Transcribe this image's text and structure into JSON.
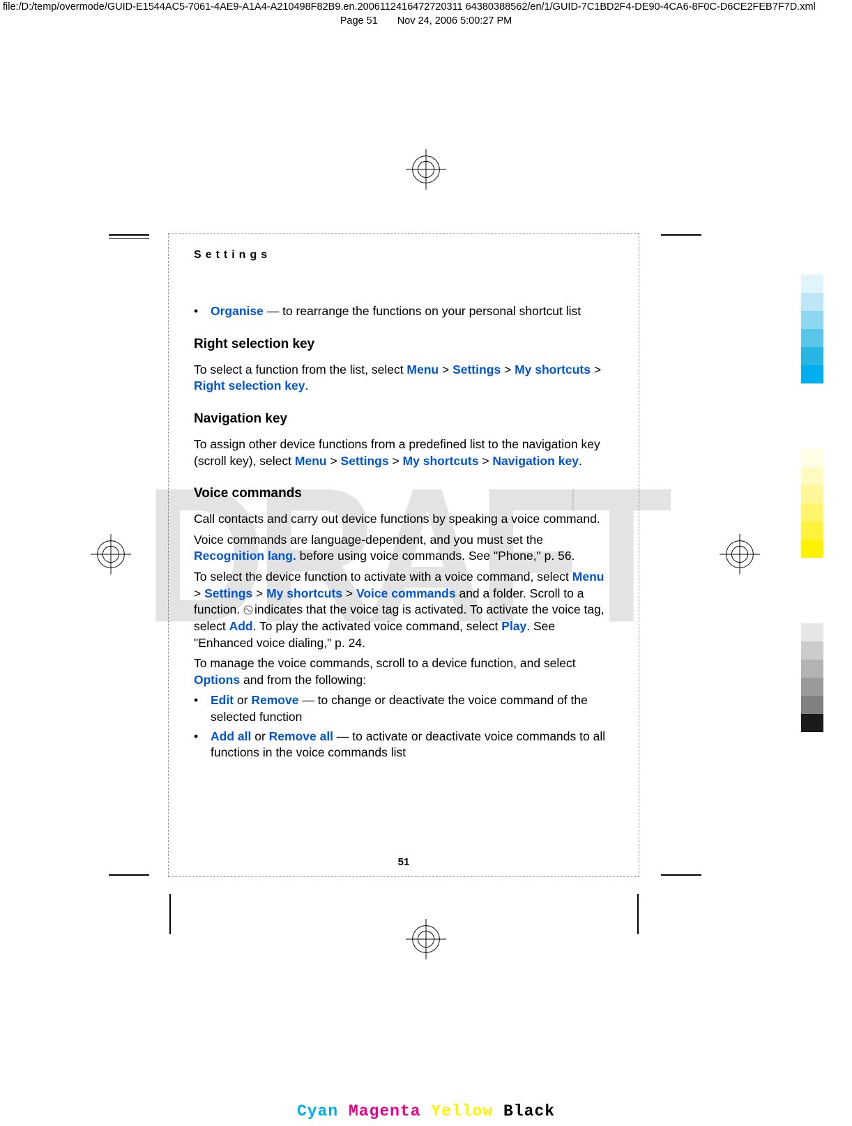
{
  "header": {
    "file_path": "file:/D:/temp/overmode/GUID-E1544AC5-7061-4AE9-A1A4-A210498F82B9.en.2006112416472720311 64380388562/en/1/GUID-7C1BD2F4-DE90-4CA6-8F0C-D6CE2FEB7F7D.xml",
    "page_label": "Page 51",
    "timestamp": "Nov 24, 2006 5:00:27 PM"
  },
  "page": {
    "running_head": "Settings",
    "watermark": "DRAFT",
    "page_number": "51"
  },
  "content": {
    "intro_bullet": {
      "kw": "Organise",
      "rest": " — to rearrange the functions on your personal shortcut list"
    },
    "right_sel": {
      "heading": "Right selection key",
      "p1a": "To select a function from the list, select ",
      "menu": "Menu",
      "gt1": " > ",
      "settings": "Settings",
      "gt2": " > ",
      "mysc": "My shortcuts",
      "gt3": " > ",
      "rsk": "Right selection key",
      "dot": "."
    },
    "nav_key": {
      "heading": "Navigation key",
      "p1a": "To assign other device functions from a predefined list to the navigation key (scroll key), select ",
      "menu": "Menu",
      "gt1": " > ",
      "settings": "Settings",
      "gt2": " > ",
      "mysc": "My shortcuts",
      "gt3": " > ",
      "nk": "Navigation key",
      "dot": "."
    },
    "voice": {
      "heading": "Voice commands",
      "p1": "Call contacts and carry out device functions by speaking a voice command.",
      "p2a": "Voice commands are language-dependent, and you must set the ",
      "p2kw": "Recognition lang.",
      "p2b": " before using voice commands. See \"Phone,\" p. 56.",
      "p3a": "To select the device function to activate with a voice command, select ",
      "p3menu": "Menu",
      "p3gt1": " > ",
      "p3settings": "Settings",
      "p3gt2": " > ",
      "p3mysc": "My shortcuts",
      "p3gt3": " > ",
      "p3vc": "Voice commands",
      "p3b": " and a folder. Scroll to a function. ",
      "p3c": "indicates that the voice tag is activated. To activate the voice tag, select ",
      "p3add": "Add",
      "p3d": ". To play the activated voice command, select ",
      "p3play": "Play",
      "p3e": ". See \"Enhanced voice dialing,\" p. 24.",
      "p4a": "To manage the voice commands, scroll to a device function, and select ",
      "p4opt": "Options",
      "p4b": " and from the following:",
      "b1": {
        "kw1": "Edit",
        "mid": " or ",
        "kw2": "Remove",
        "rest": " — to change or deactivate the voice command of the selected function"
      },
      "b2": {
        "kw1": "Add all",
        "mid": " or ",
        "kw2": "Remove all",
        "rest": " — to activate or deactivate voice commands to all functions in the voice commands list"
      }
    }
  },
  "colorbars": {
    "cyan": [
      "#e1f4fb",
      "#bde7f6",
      "#8dd7f0",
      "#59c6e9",
      "#27b6e3",
      "#00aeef"
    ],
    "yellow": [
      "#fffde6",
      "#fffac2",
      "#fff799",
      "#fff46b",
      "#fff23d",
      "#fff200"
    ],
    "grey": [
      "#e6e6e6",
      "#cccccc",
      "#b3b3b3",
      "#999999",
      "#808080",
      "#1a1a1a"
    ]
  },
  "footer": {
    "c": "Cyan",
    "m": "Magenta",
    "y": "Yellow",
    "k": "Black"
  }
}
